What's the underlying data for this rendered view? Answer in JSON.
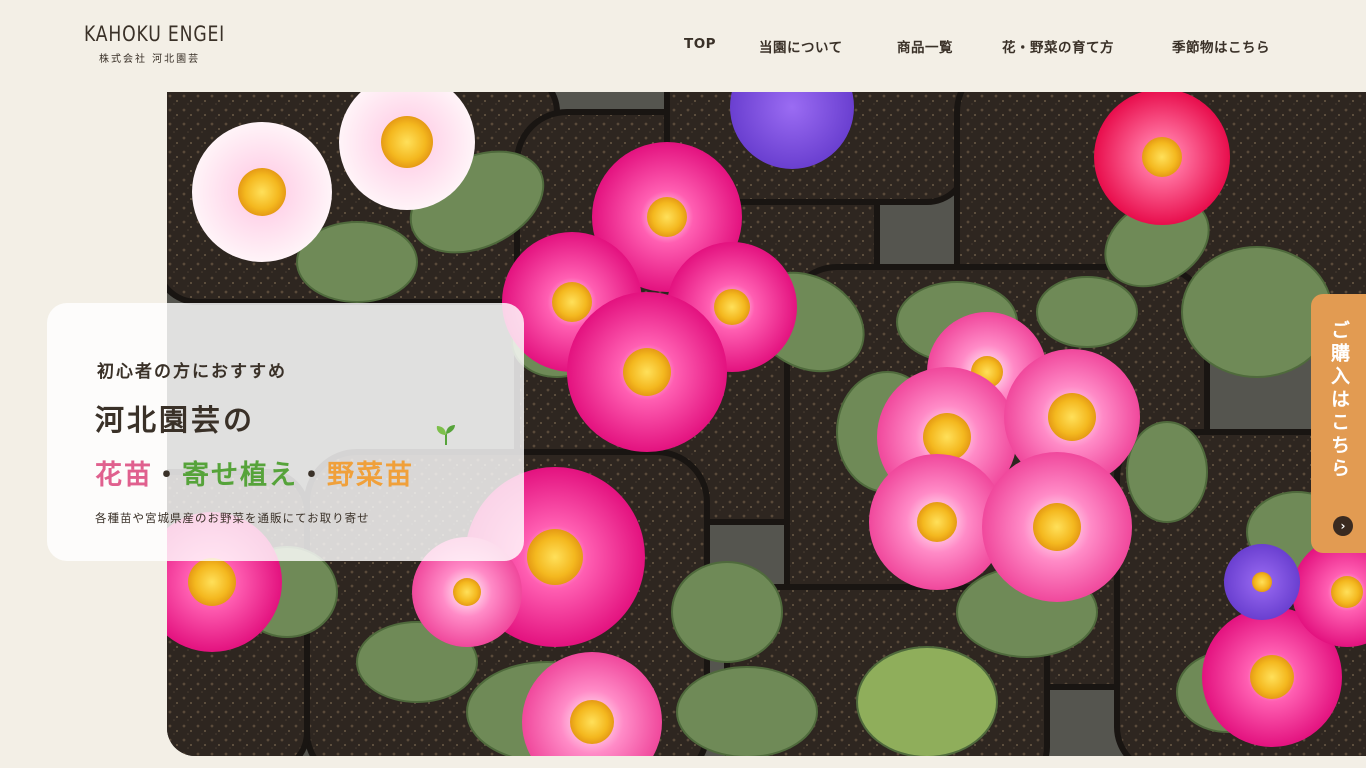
{
  "header": {
    "logo_en": "KAHOKU ENGEI",
    "logo_jp": "株式会社 河北園芸",
    "nav": [
      {
        "label": "TOP"
      },
      {
        "label": "当園について"
      },
      {
        "label": "商品一覧"
      },
      {
        "label": "花・野菜の育て方"
      },
      {
        "label": "季節物はこちら"
      }
    ]
  },
  "hero": {
    "eyebrow": "初心者の方におすすめ",
    "title": "河北園芸の",
    "products": {
      "p1": "花苗",
      "sep1": "・",
      "p2": "寄せ植え",
      "sep2": "・",
      "p3": "野菜苗"
    },
    "description": "各種苗や宮城県産のお野菜を通販にてお取り寄せ",
    "image_alt": "primrose-flowers-photo"
  },
  "side_tab": {
    "label": "ご購入はこちら",
    "arrow": "›"
  },
  "colors": {
    "background": "#f3efe6",
    "flower_pink": "#e0608e",
    "plant_green": "#56a33a",
    "veg_orange": "#f0a03a",
    "tab_orange": "#e29b52",
    "text": "#3a3128"
  }
}
